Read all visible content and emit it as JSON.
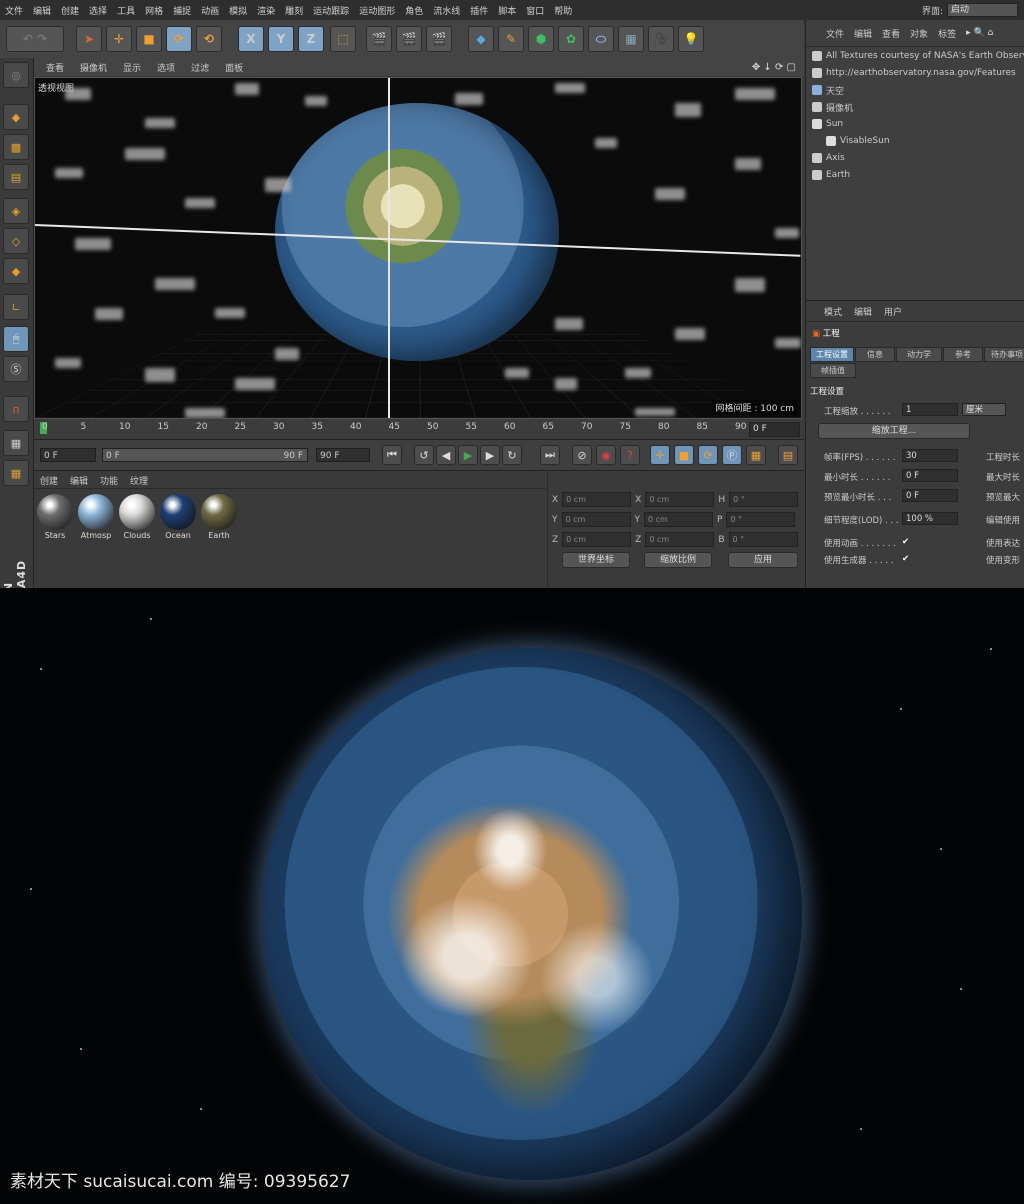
{
  "menubar": {
    "items": [
      "文件",
      "编辑",
      "创建",
      "选择",
      "工具",
      "网格",
      "捕捉",
      "动画",
      "模拟",
      "渲染",
      "雕刻",
      "运动跟踪",
      "运动图形",
      "角色",
      "流水线",
      "插件",
      "脚本",
      "窗口",
      "帮助"
    ],
    "layout_label": "界面:",
    "layout_value": "启动"
  },
  "toolbar": {
    "axis_buttons": [
      "X",
      "Y",
      "Z"
    ]
  },
  "viewport": {
    "menu": [
      "查看",
      "摄像机",
      "显示",
      "选项",
      "过滤",
      "面板"
    ],
    "label": "透视视图",
    "status": "网格间距 : 100 cm"
  },
  "timeline": {
    "ticks": [
      "0",
      "5",
      "10",
      "15",
      "20",
      "25",
      "30",
      "35",
      "40",
      "45",
      "50",
      "55",
      "60",
      "65",
      "70",
      "75",
      "80",
      "85",
      "90"
    ],
    "current_frame": "0 F"
  },
  "transport": {
    "start_field": "0 F",
    "range_start": "0 F",
    "range_end": "90 F",
    "end_field": "90 F"
  },
  "materials": {
    "menu": [
      "创建",
      "编辑",
      "功能",
      "纹理"
    ],
    "items": [
      {
        "name": "Stars",
        "color": "#6e6e6e"
      },
      {
        "name": "Atmosp",
        "color": "#8fb5d8"
      },
      {
        "name": "Clouds",
        "color": "#d9d9d9"
      },
      {
        "name": "Ocean",
        "color": "#1e3f73"
      },
      {
        "name": "Earth",
        "color": "#6f6a44"
      }
    ]
  },
  "coordinates": {
    "rows": [
      {
        "a": "X",
        "av": "0 cm",
        "b": "X",
        "bv": "0 cm",
        "c": "H",
        "cv": "0 °"
      },
      {
        "a": "Y",
        "av": "0 cm",
        "b": "Y",
        "bv": "0 cm",
        "c": "P",
        "cv": "0 °"
      },
      {
        "a": "Z",
        "av": "0 cm",
        "b": "Z",
        "bv": "0 cm",
        "c": "B",
        "cv": "0 °"
      }
    ],
    "world_dropdown": "世界坐标",
    "scale_dropdown": "缩放比例",
    "apply_button": "应用"
  },
  "object_manager": {
    "menu": [
      "文件",
      "编辑",
      "查看",
      "对象",
      "标签"
    ],
    "objects": [
      {
        "name": "All Textures courtesy of NASA's Earth Observ",
        "indent": 0
      },
      {
        "name": "http://earthobservatory.nasa.gov/Features",
        "indent": 0
      },
      {
        "name": "天空",
        "indent": 0
      },
      {
        "name": "摄像机",
        "indent": 0
      },
      {
        "name": "Sun",
        "indent": 0
      },
      {
        "name": "VisableSun",
        "indent": 1
      },
      {
        "name": "Axis",
        "indent": 0
      },
      {
        "name": "Earth",
        "indent": 0
      }
    ]
  },
  "attributes": {
    "menu": [
      "模式",
      "编辑",
      "用户"
    ],
    "title": "工程",
    "tabs": [
      "工程设置",
      "信息",
      "动力学",
      "参考",
      "待办事项"
    ],
    "tab2": "帧插值",
    "section": "工程设置",
    "scale_label": "工程缩放 . . . . . .",
    "scale_value": "1",
    "scale_unit": "厘米",
    "scale_button": "缩放工程...",
    "fields": [
      {
        "label": "帧率(FPS) . . . . . .",
        "value": "30",
        "right": "工程时长"
      },
      {
        "label": "最小时长 . . . . . .",
        "value": "0 F",
        "right": "最大时长"
      },
      {
        "label": "预览最小时长 . . .",
        "value": "0 F",
        "right": "预览最大"
      }
    ],
    "lod_label": "细节程度(LOD) . . .",
    "lod_value": "100 %",
    "lod_right": "编辑使用",
    "checks": [
      {
        "label": "使用动画 . . . . . . .",
        "check": "✔",
        "right": "使用表达"
      },
      {
        "label": "使用生成器 . . . . .",
        "check": "✔",
        "right": "使用变形"
      }
    ]
  },
  "watermark": "素材天下 sucaisucai.com  编号: 09395627"
}
